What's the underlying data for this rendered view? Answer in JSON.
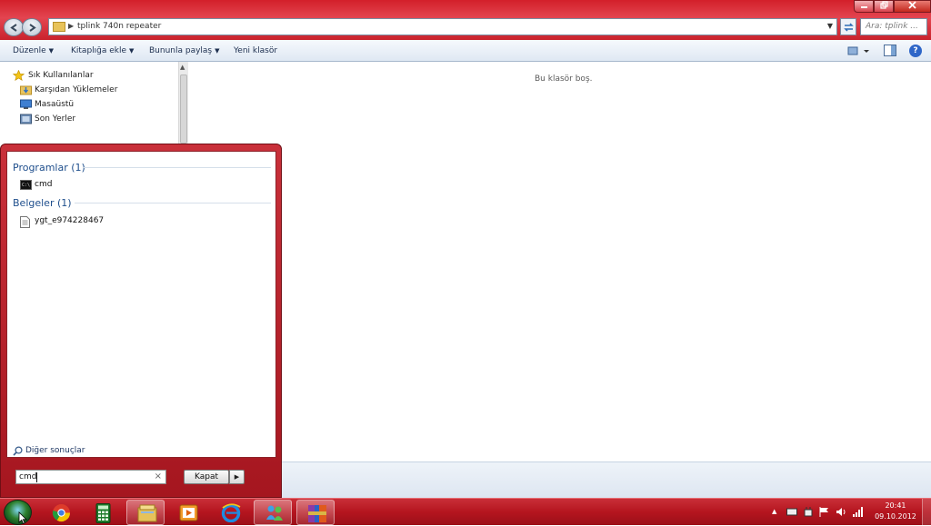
{
  "window": {
    "address_path": "tplink 740n repeater",
    "search_placeholder": "Ara: tplink ...",
    "controls": {
      "minimize": "0",
      "maximize": "1",
      "close": "r"
    }
  },
  "toolbar": {
    "organize": "Düzenle",
    "include_in_library": "Kitaplığa ekle",
    "share_with": "Bununla paylaş",
    "new_folder": "Yeni klasör",
    "help": "?"
  },
  "nav": {
    "items": [
      {
        "label": "Sık Kullanılanlar",
        "icon": "star-icon"
      },
      {
        "label": "Karşıdan Yüklemeler",
        "icon": "downloads-folder-icon"
      },
      {
        "label": "Masaüstü",
        "icon": "desktop-icon"
      },
      {
        "label": "Son Yerler",
        "icon": "recent-places-icon"
      }
    ]
  },
  "content": {
    "empty_message": "Bu klasör boş."
  },
  "start_menu": {
    "sections": [
      {
        "header": "Programlar (1)",
        "items": [
          {
            "label": "cmd",
            "icon": "cmd-icon"
          }
        ]
      },
      {
        "header": "Belgeler (1)",
        "items": [
          {
            "label": "ygt_e974228467",
            "icon": "document-icon"
          }
        ]
      }
    ],
    "more_results": "Diğer sonuçlar",
    "search_value": "cmd",
    "clear_glyph": "×",
    "shutdown_label": "Kapat"
  },
  "taskbar": {
    "apps": [
      "chrome-icon",
      "calculator-icon",
      "windows-explorer-icon",
      "media-player-icon",
      "internet-explorer-icon",
      "messenger-icon",
      "winrar-icon"
    ],
    "clock_time": "20:41",
    "clock_date": "09.10.2012"
  }
}
